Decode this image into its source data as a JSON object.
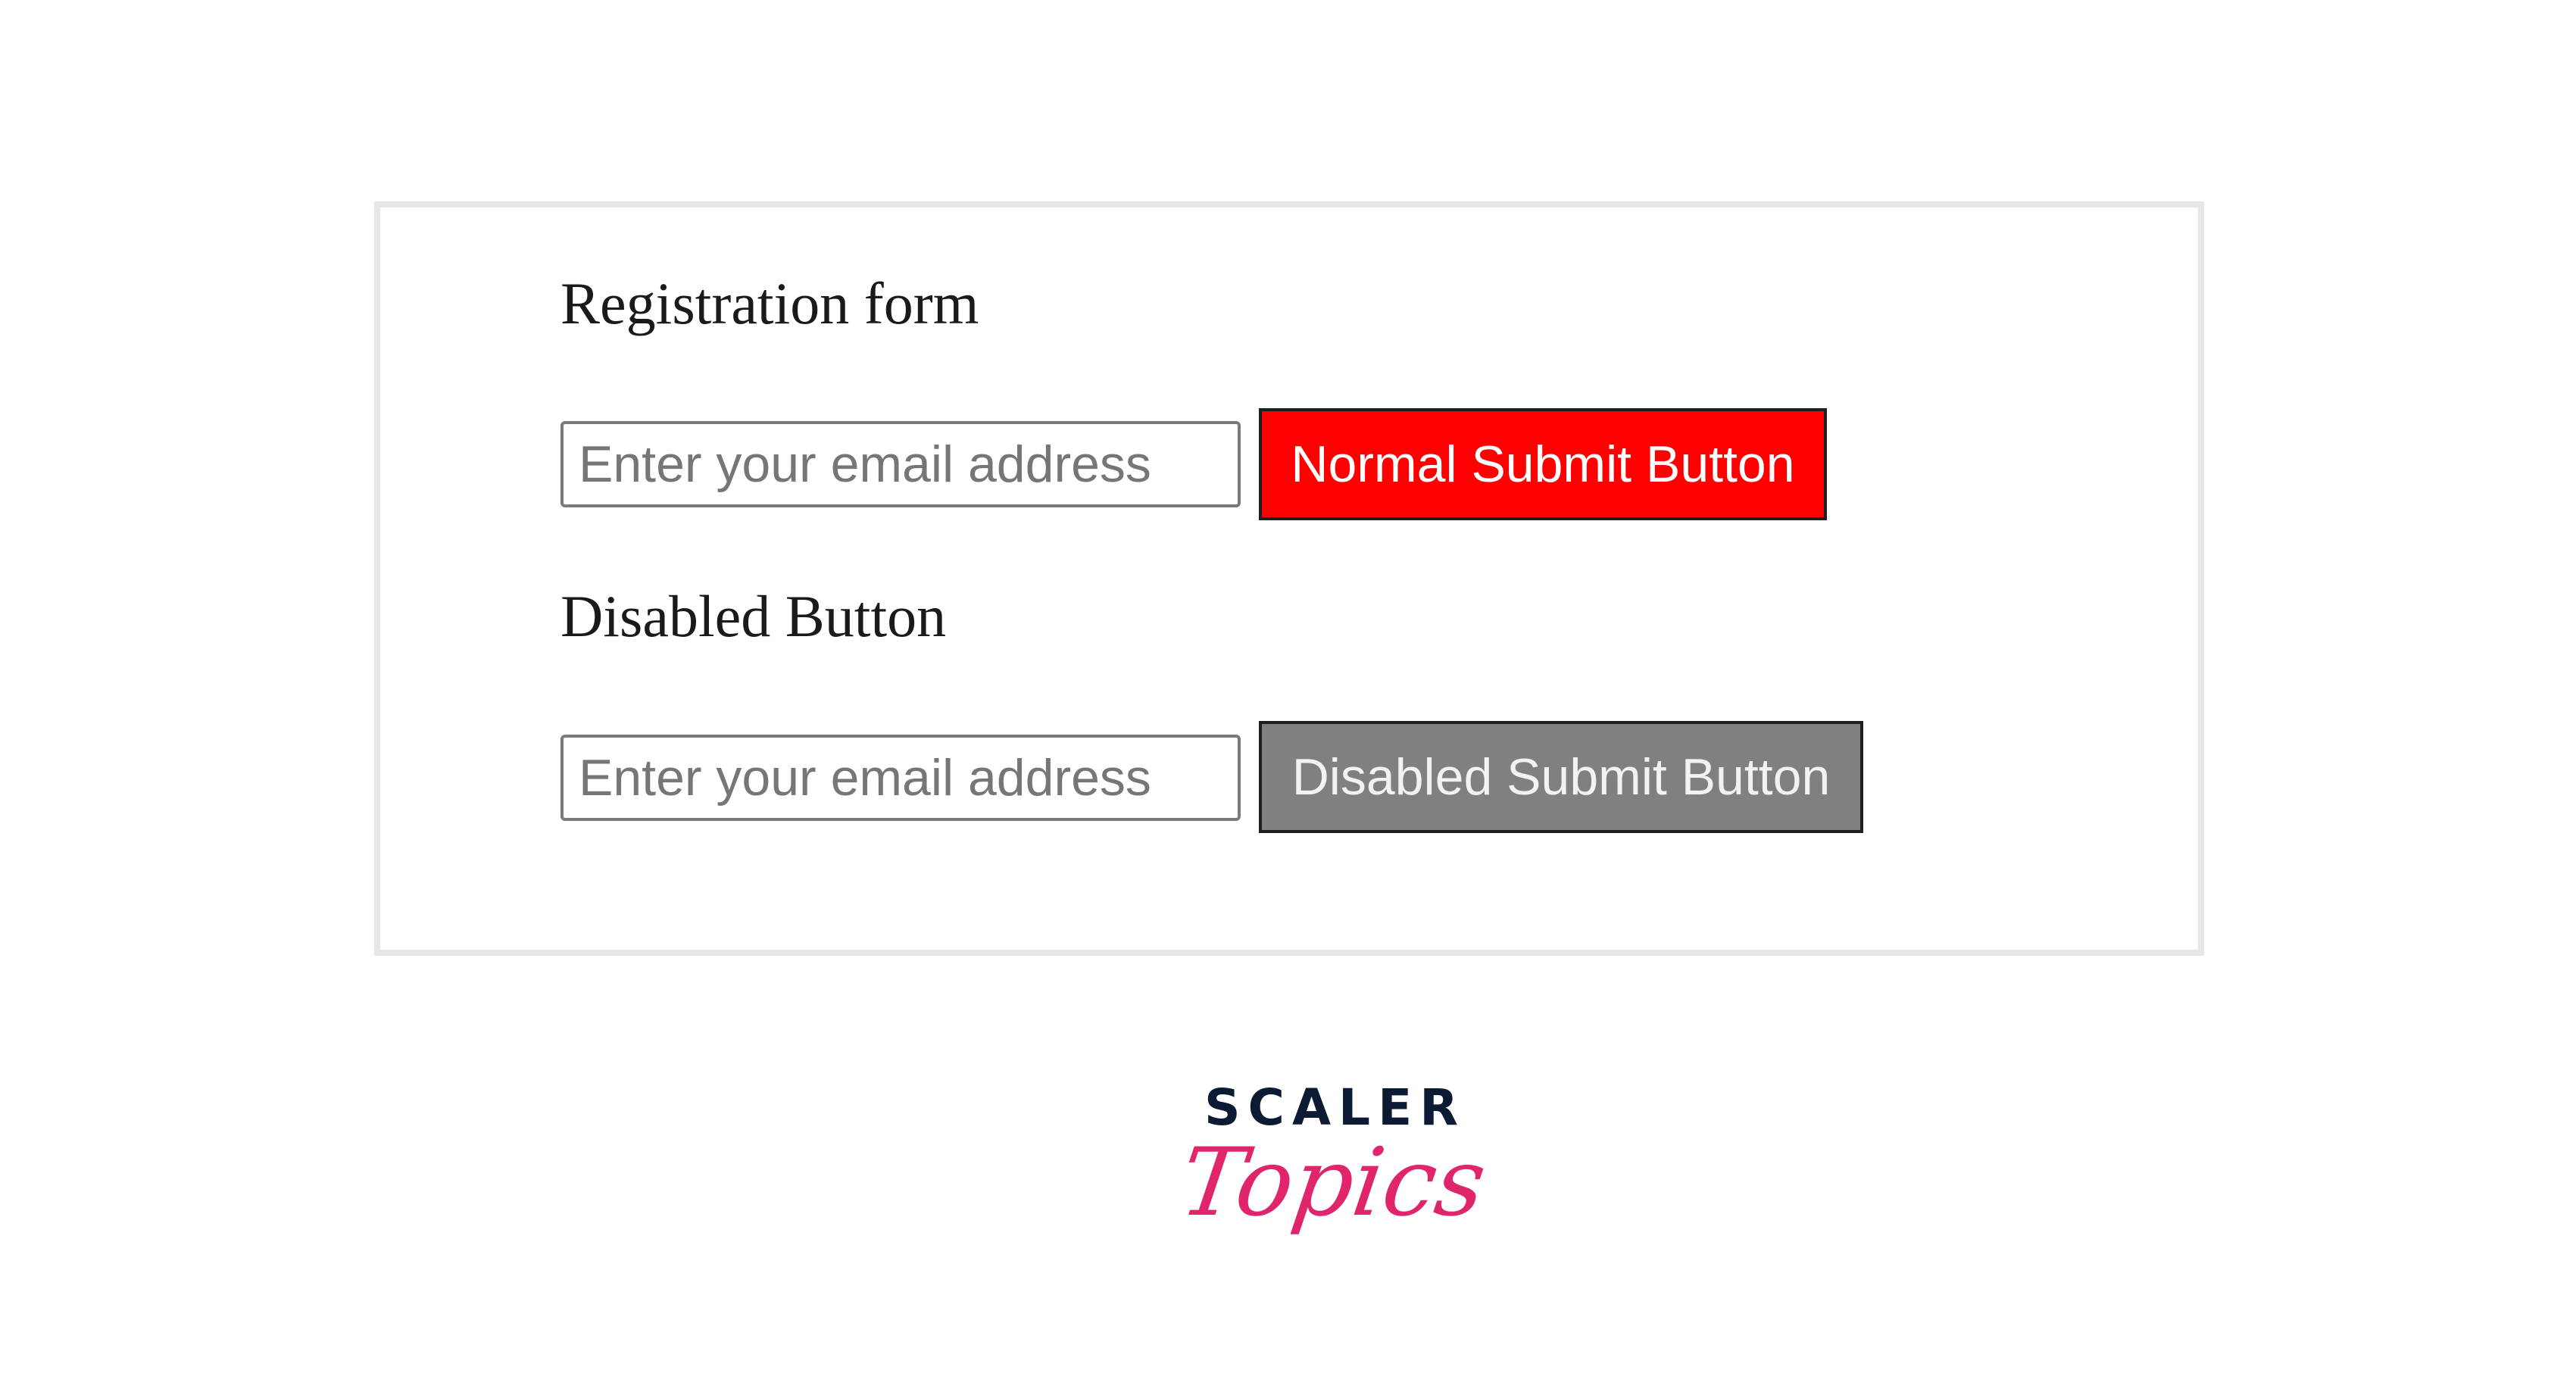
{
  "form": {
    "title": "Registration form",
    "email_placeholder": "Enter your email address",
    "submit_label": "Normal Submit Button",
    "submit_color": "#ff0000"
  },
  "disabled_section": {
    "title": "Disabled Button",
    "email_placeholder": "Enter your email address",
    "submit_label": "Disabled Submit Button",
    "submit_color": "#808080"
  },
  "brand": {
    "logo_top": "SCALER",
    "logo_bottom": "Topics",
    "logo_top_color": "#0b1b33",
    "logo_bottom_color": "#e0256d"
  }
}
